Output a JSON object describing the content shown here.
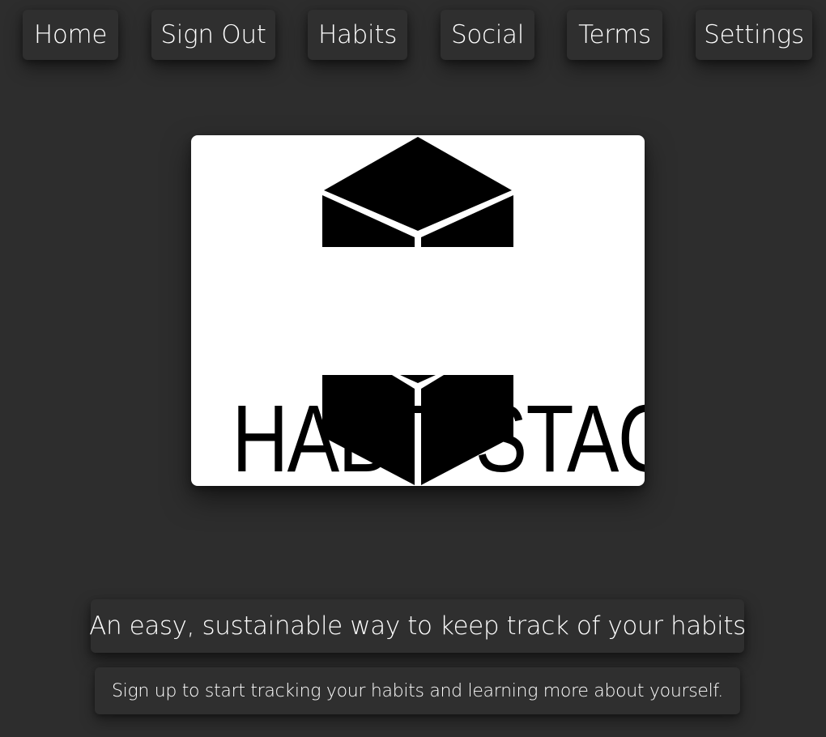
{
  "nav": {
    "home": "Home",
    "sign_out": "Sign Out",
    "habits": "Habits",
    "social": "Social",
    "terms": "Terms",
    "settings": "Settings"
  },
  "logo": {
    "text": "HABIT STACK"
  },
  "hero": {
    "tagline": "An easy, sustainable way to keep track of your habits",
    "subtext": "Sign up to start tracking your habits and learning more about yourself."
  },
  "colors": {
    "background": "#2d2d2d",
    "card": "#2f2f2f",
    "logo_background": "#ffffff",
    "logo_ink": "#000000",
    "text": "#ffffff"
  }
}
